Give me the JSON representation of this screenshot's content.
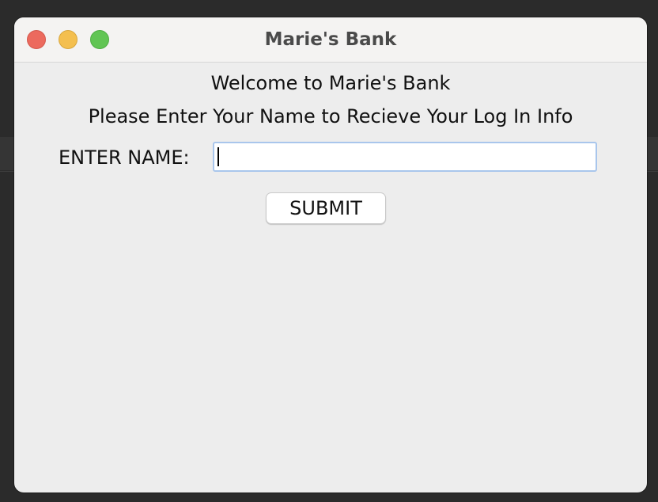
{
  "window": {
    "title": "Marie's Bank",
    "controls": {
      "close_icon": "close-icon",
      "minimize_icon": "minimize-icon",
      "maximize_icon": "maximize-icon",
      "close_color": "#ec6a5e",
      "minimize_color": "#f4bf4f",
      "maximize_color": "#61c554"
    }
  },
  "form": {
    "welcome_text": "Welcome to Marie's Bank",
    "instructions_text": "Please Enter Your Name to Recieve Your Log In Info",
    "name_label": "ENTER NAME:",
    "name_value": "",
    "submit_label": "SUBMIT"
  }
}
